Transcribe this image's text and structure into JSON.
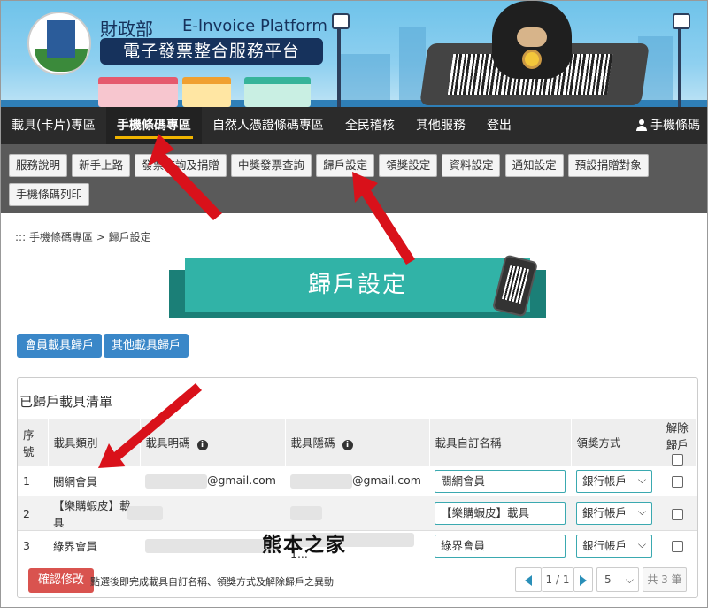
{
  "header": {
    "ministry": "財政部",
    "platform_en": "E-Invoice Platform",
    "platform_cn": "電子發票整合服務平台"
  },
  "main_nav": {
    "items": [
      {
        "label": "載具(卡片)專區"
      },
      {
        "label": "手機條碼專區",
        "active": true
      },
      {
        "label": "自然人憑證條碼專區"
      },
      {
        "label": "全民稽核"
      },
      {
        "label": "其他服務"
      },
      {
        "label": "登出"
      }
    ],
    "user_label": "手機條碼"
  },
  "sub_nav": {
    "items": [
      {
        "label": "服務說明"
      },
      {
        "label": "新手上路"
      },
      {
        "label": "發票查詢及捐贈"
      },
      {
        "label": "中獎發票查詢"
      },
      {
        "label": "歸戶設定"
      },
      {
        "label": "領獎設定"
      },
      {
        "label": "資料設定"
      },
      {
        "label": "通知設定"
      },
      {
        "label": "預設捐贈對象"
      },
      {
        "label": "手機條碼列印"
      }
    ]
  },
  "breadcrumb": "::: 手機條碼專區 > 歸戶設定",
  "page_heading": "歸戶設定",
  "actions": {
    "member_carrier": "會員載具歸戶",
    "other_carrier": "其他載具歸戶"
  },
  "list": {
    "heading": "已歸戶載具清單",
    "columns": {
      "seq": "序號",
      "type": "載具類別",
      "visible_code": "載具明碼",
      "hidden_code": "載具隱碼",
      "custom_name": "載具自訂名稱",
      "award_method": "領獎方式",
      "unbind": "解除歸戶"
    },
    "rows": [
      {
        "seq": "1",
        "type": "關網會員",
        "visible_suffix": "@gmail.com",
        "hidden_suffix": "@gmail.com",
        "custom_name": "關網會員",
        "award": "銀行帳戶"
      },
      {
        "seq": "2",
        "type": "【樂購蝦皮】載具",
        "visible_suffix": "",
        "hidden_suffix": "",
        "custom_name": "【樂購蝦皮】載具",
        "award": "銀行帳戶"
      },
      {
        "seq": "3",
        "type": "綠界會員",
        "visible_suffix": "",
        "hidden_suffix": "1...",
        "custom_name": "綠界會員",
        "award": "銀行帳戶"
      }
    ]
  },
  "footer": {
    "confirm": "確認修改",
    "note": "點選後即完成載具自訂名稱、領獎方式及解除歸戶之異動",
    "page": "1 / 1",
    "page_size": "5",
    "total": "共 3 筆"
  },
  "watermark": "熊本之家",
  "colors": {
    "nav_bg": "#2b2b2b",
    "subnav_bg": "#5a5a5a",
    "teal": "#31b3a7",
    "blue_button": "#3a87c8",
    "red_button": "#d9534f",
    "arrow_red": "#d11"
  }
}
